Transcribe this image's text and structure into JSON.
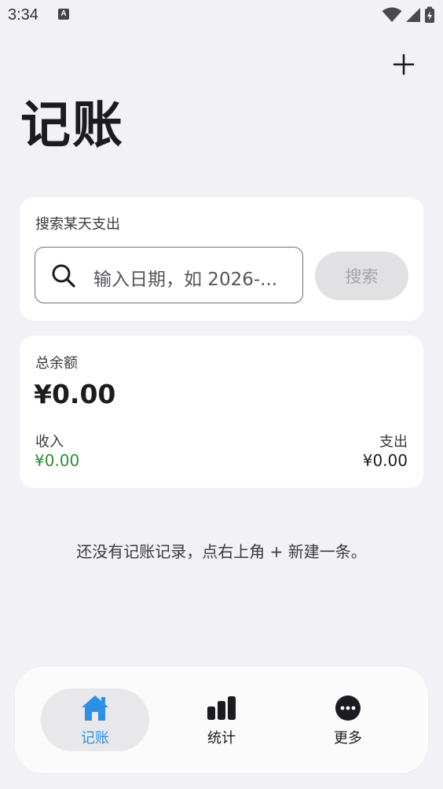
{
  "status_bar": {
    "time": "3:34",
    "notification_icon": "A"
  },
  "header": {
    "title": "记账",
    "add_icon": "plus-icon"
  },
  "search": {
    "label": "搜索某天支出",
    "placeholder": "输入日期，如 2026-...",
    "button_label": "搜索"
  },
  "balance": {
    "label": "总余额",
    "value": "¥0.00",
    "income_label": "收入",
    "income_value": "¥0.00",
    "expense_label": "支出",
    "expense_value": "¥0.00"
  },
  "empty_message": "还没有记账记录，点右上角 + 新建一条。",
  "nav": {
    "items": [
      {
        "label": "记账",
        "icon": "home-icon",
        "active": true
      },
      {
        "label": "统计",
        "icon": "bar-chart-icon",
        "active": false
      },
      {
        "label": "更多",
        "icon": "more-icon",
        "active": false
      }
    ]
  },
  "colors": {
    "accent": "#2E8FE6",
    "income": "#2E8B36",
    "background": "#F2F1F6"
  }
}
